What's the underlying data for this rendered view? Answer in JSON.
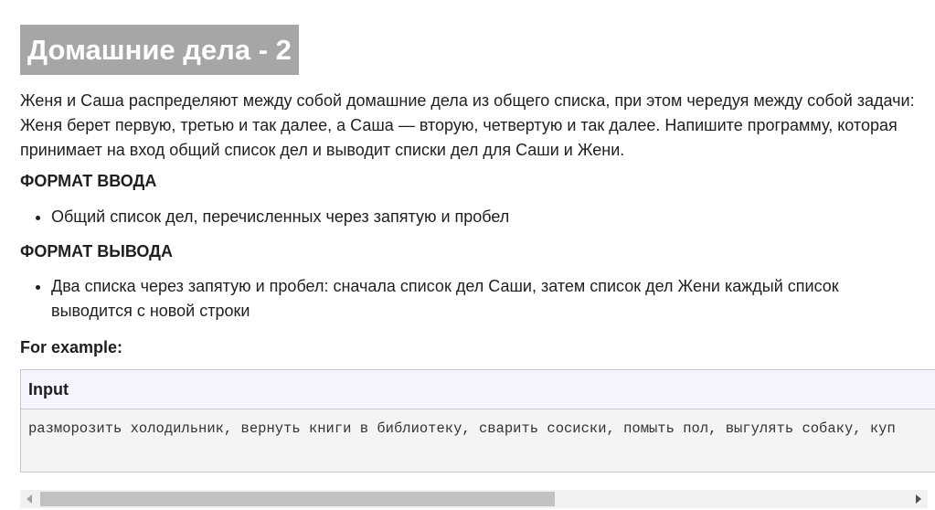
{
  "title": "Домашние дела - 2",
  "description": "Женя и Саша распределяют между собой домашние дела из общего списка, при этом чередуя между собой задачи: Женя берет первую, третью и так далее, а Саша — вторую, четвертую и так далее. Напишите программу, которая принимает на вход общий список дел и выводит списки дел для Саши и Жени.",
  "input_format": {
    "heading": "ФОРМАТ ВВОДА",
    "items": [
      "Общий список дел, перечисленных через запятую и пробел"
    ]
  },
  "output_format": {
    "heading": "ФОРМАТ ВЫВОДА",
    "items": [
      "Два списка через запятую и пробел: сначала список дел Саши, затем список дел Жени каждый список выводится с новой строки"
    ]
  },
  "example": {
    "label": "For example:",
    "input_header": "Input",
    "input_value": "разморозить холодильник, вернуть книги в библиотеку, сварить сосиски, помыть пол, выгулять собаку, куп"
  },
  "scrollbar": {
    "left_arrow_icon": "triangle-left-icon",
    "right_arrow_icon": "triangle-right-icon",
    "thumb_color": "#c1c1c1",
    "track_color": "#f1f1f1"
  },
  "colors": {
    "title_bg": "#a6a6a6",
    "io_header_bg": "#f5f5ff",
    "io_body_bg": "#f4f4f4"
  }
}
